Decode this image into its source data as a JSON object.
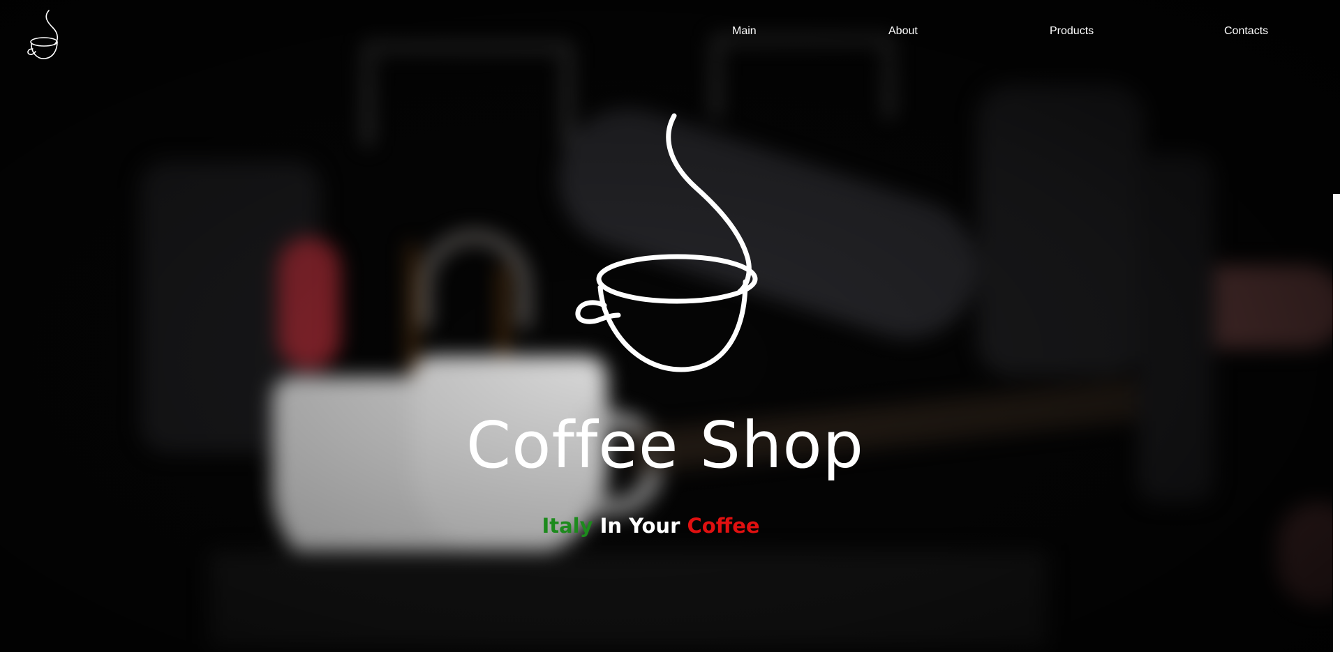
{
  "nav": {
    "items": [
      {
        "label": "Main"
      },
      {
        "label": "About"
      },
      {
        "label": "Products"
      },
      {
        "label": "Contacts"
      }
    ]
  },
  "hero": {
    "title": "Coffee Shop",
    "tagline": {
      "part1": "Italy",
      "part2": "In Your",
      "part3": "Coffee"
    }
  },
  "icons": {
    "logo": "coffee-cup-icon",
    "hero": "coffee-cup-icon"
  },
  "colors": {
    "background": "#050505",
    "text": "#ffffff",
    "italy_green": "#1d8a1d",
    "italy_red": "#e01010"
  }
}
